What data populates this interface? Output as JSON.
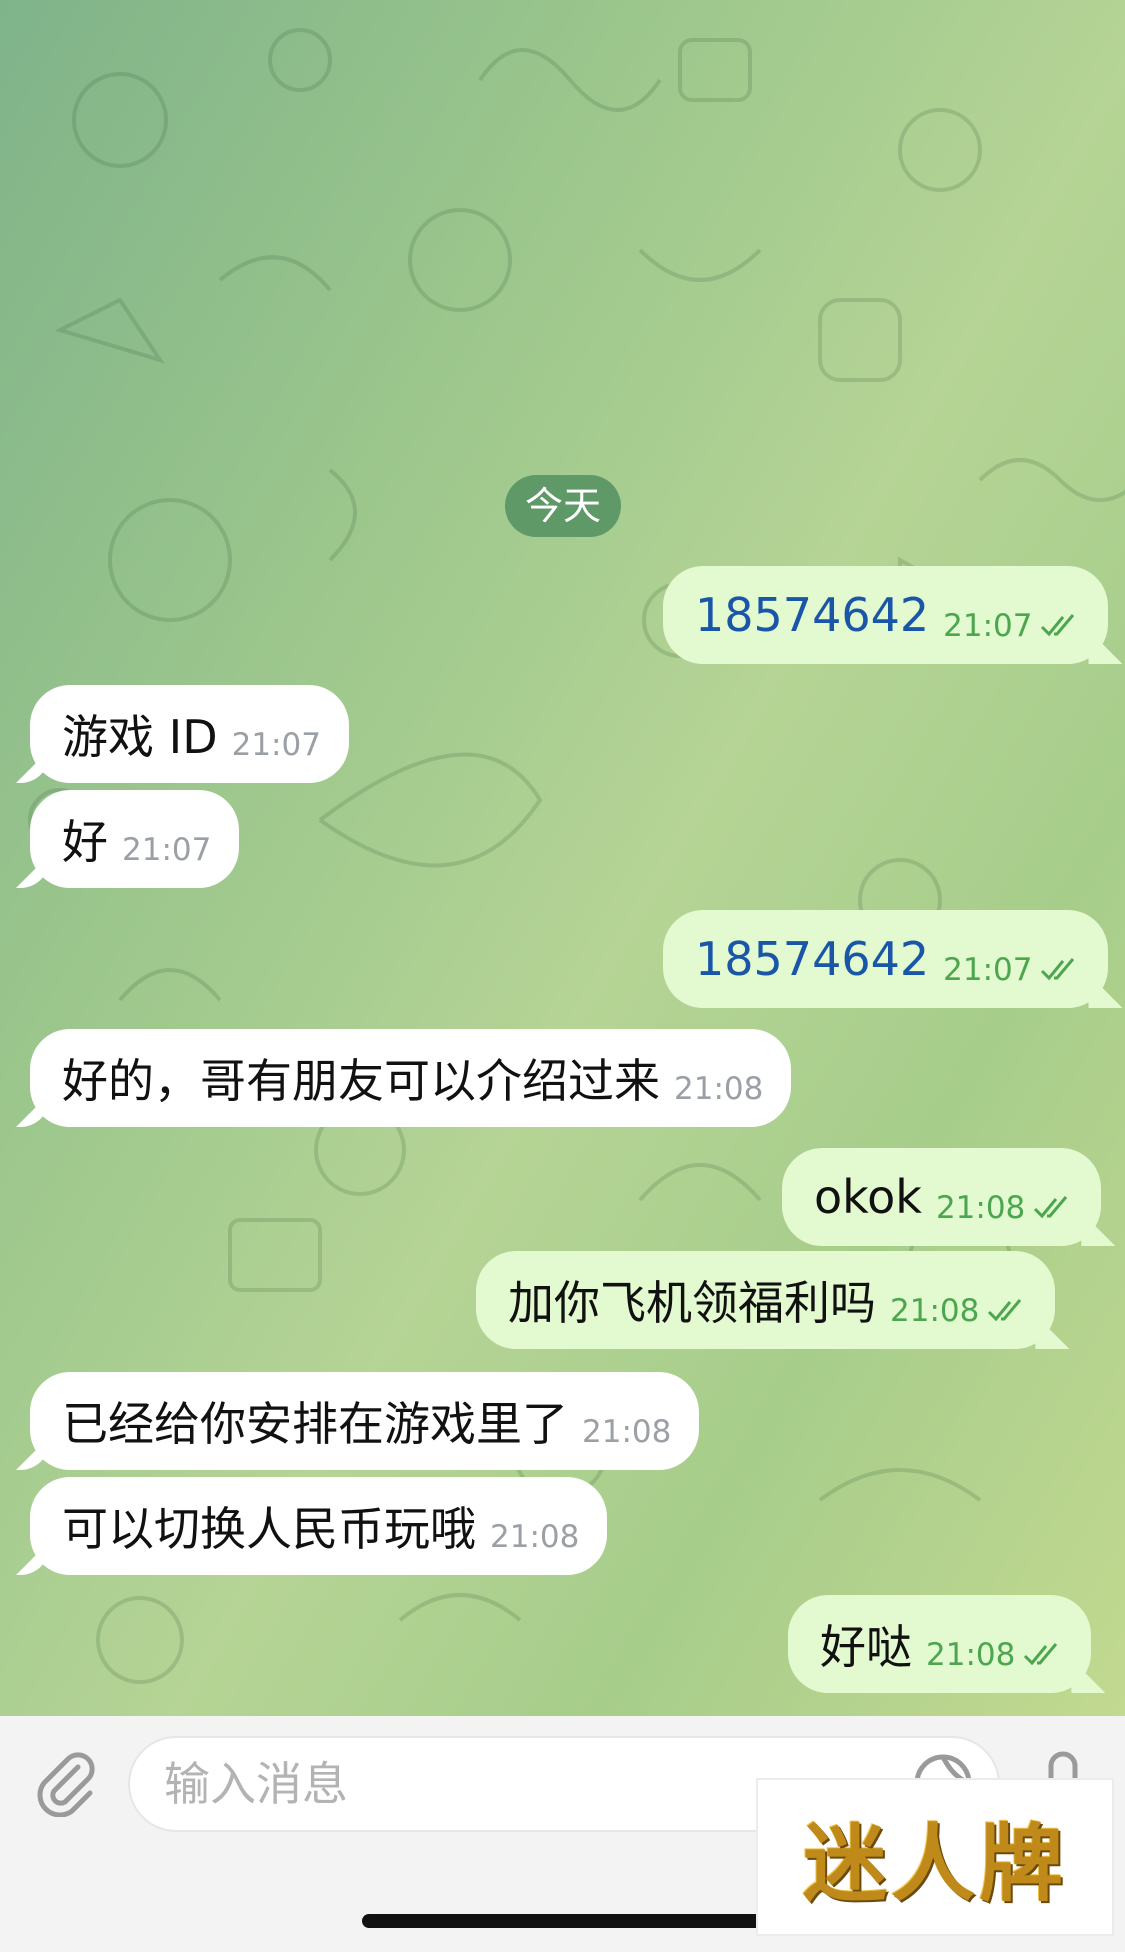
{
  "chat": {
    "date_separator": "今天",
    "messages": [
      {
        "direction": "out",
        "text": "18574642",
        "time": "21:07",
        "read": true
      },
      {
        "direction": "in",
        "text": "游戏 ID",
        "time": "21:07"
      },
      {
        "direction": "in",
        "text": "好",
        "time": "21:07"
      },
      {
        "direction": "out",
        "text": "18574642",
        "time": "21:07",
        "read": true
      },
      {
        "direction": "in",
        "text": "好的，哥有朋友可以介绍过来",
        "time": "21:08"
      },
      {
        "direction": "out",
        "text": "okok",
        "time": "21:08",
        "read": true
      },
      {
        "direction": "out",
        "text": "加你飞机领福利吗",
        "time": "21:08",
        "read": true
      },
      {
        "direction": "in",
        "text": "已经给你安排在游戏里了",
        "time": "21:08"
      },
      {
        "direction": "in",
        "text": "可以切换人民币玩哦",
        "time": "21:08"
      },
      {
        "direction": "out",
        "text": "好哒",
        "time": "21:08",
        "read": true
      }
    ]
  },
  "input": {
    "placeholder": "输入消息",
    "value": ""
  },
  "icons": {
    "attach": "paperclip-icon",
    "sticker": "sticker-icon",
    "mic": "microphone-icon",
    "read_receipt": "double-check-icon"
  },
  "watermark": {
    "text": "迷人牌"
  },
  "colors": {
    "outgoing_bubble": "#e3f9cf",
    "incoming_bubble": "#ffffff",
    "number_link": "#1a56a8",
    "outgoing_time": "#4ca64f",
    "date_pill": "#5f9968"
  }
}
